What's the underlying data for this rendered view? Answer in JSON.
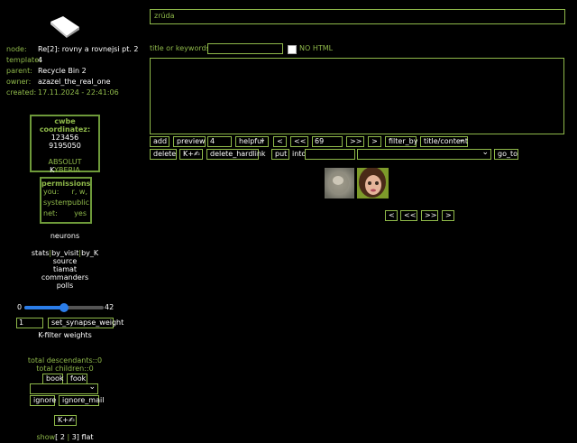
{
  "node_info": {
    "node_label": "node:",
    "node_value": "Re[2]: rovny a rovnejsi pt. 2",
    "template_label": "template:",
    "template_value": "4",
    "parent_label": "parent:",
    "parent_value": "Recycle Bin 2",
    "owner_label": "owner:",
    "owner_value": "azazel_the_real_one",
    "created_label": "created:",
    "created_value": "17.11.2024 - 22:41:06"
  },
  "coords": {
    "title": "cwbe coordinatez:",
    "line1": "123456",
    "line2": "9195050",
    "line3": "ABSOLUT",
    "line4_k": "K",
    "line4_rest": "YBERIA"
  },
  "permissions": {
    "title": "permissions",
    "you_label": "you:",
    "you_value": "r, w,",
    "system_label": "system:",
    "system_value": "public",
    "net_label": "net:",
    "net_value": "yes"
  },
  "side_links": {
    "neurons": "neurons",
    "stats": "stats",
    "sep1": "|",
    "by_visit": "by_visit",
    "sep2": "|",
    "by_k": "by_K",
    "source": "source",
    "tiamat": "tiamat",
    "commanders": "commanders",
    "polls": "polls"
  },
  "synapse": {
    "min": "0",
    "max": "42",
    "level": 0.5,
    "weight_value": "1",
    "set_button": "set_synapse_weight",
    "k_filter": "K-filter weights"
  },
  "descendants": {
    "total_desc": "total descendants::0",
    "total_children": "total children::0",
    "book": "book",
    "fook": "fook",
    "ignore": "ignore",
    "ignore_mail": "ignore_mail",
    "kplus": "K+✍"
  },
  "view": {
    "show": "show",
    "open": "[",
    "opt1": "2",
    "sep": "|",
    "opt2": "3",
    "close": "]",
    "flat": "flat"
  },
  "main": {
    "title_value": "zrúda",
    "keywords_label": "title or keywords::",
    "keywords_value": "",
    "nohtml_label": "NO HTML",
    "textarea_value": ""
  },
  "toolbar1": {
    "add": "add",
    "preview": "preview",
    "num": "4",
    "helpful": "helpful",
    "lt": "<",
    "llt": "<<",
    "offset": "69",
    "ggt": ">>",
    "gt": ">",
    "filter_by": "filter_by",
    "title_content": "title/content"
  },
  "toolbar2": {
    "delete": "delete",
    "kplus": "K+✍",
    "delete_hardlink": "delete_hardlink",
    "put": "put",
    "into": "into",
    "into_value": "",
    "select_value": "",
    "go_to": "go_to"
  },
  "pager": {
    "lt": "<",
    "llt": "<<",
    "ggt": ">>",
    "gt": ">"
  },
  "colors": {
    "accent": "#8fb94a",
    "border": "#6e9a3a",
    "background": "#000000"
  },
  "icons": {
    "logo": "open-book-icon",
    "avatar1": "avatar-blurred",
    "avatar2": "avatar-face"
  }
}
